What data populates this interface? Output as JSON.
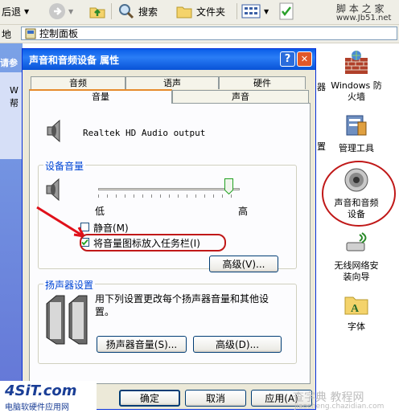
{
  "toolbar": {
    "back_label": "后退",
    "search_label": "搜索",
    "folders_label": "文件夹",
    "watermark_top": "脚 本 之 家",
    "watermark_url": "www.Jb51.net"
  },
  "address": {
    "value": "控制面板"
  },
  "taskpane": {
    "heading": "请参",
    "item_1": "W",
    "item_2": "帮"
  },
  "control_panel_icons": [
    {
      "label": "Windows 防\n火墙"
    },
    {
      "label": "管理工具"
    },
    {
      "label": "声音和音频\n设备"
    },
    {
      "label": "无线网络安\n装向导"
    },
    {
      "label": "字体"
    }
  ],
  "background_fragments": {
    "frag_1": "置",
    "frag_2": "器"
  },
  "dialog": {
    "title": "声音和音频设备 属性",
    "help_button": "?",
    "close_button": "✕",
    "tabs_back": [
      "音频",
      "语声",
      "硬件"
    ],
    "tabs_front": [
      "音量",
      "声音"
    ],
    "device_name": "Realtek HD Audio output",
    "device_volume": {
      "group_label": "设备音量",
      "low_label": "低",
      "high_label": "高",
      "level": 0.95,
      "mute_label": "静音(M)",
      "mute_checked": false,
      "tray_label": "将音量图标放入任务栏(I)",
      "tray_checked": true,
      "advanced_button": "高级(V)..."
    },
    "speaker_settings": {
      "group_label": "扬声器设置",
      "description": "用下列设置更改每个扬声器音量和其他设置。",
      "speaker_volume_button": "扬声器音量(S)...",
      "advanced_button": "高级(D)..."
    },
    "buttons": {
      "ok": "确定",
      "cancel": "取消",
      "apply": "应用(A)"
    }
  },
  "watermarks": {
    "logo_text": "4SiT.com",
    "logo_subtitle": "电脑软硬件应用网",
    "bottom_right": "查字典 教程网",
    "bottom_right_url": "jiaocheng.chazidian.com"
  },
  "colors": {
    "titlebar": "#0a5ee8",
    "annotation_red": "#e0101a",
    "group_label": "#0046d5"
  }
}
